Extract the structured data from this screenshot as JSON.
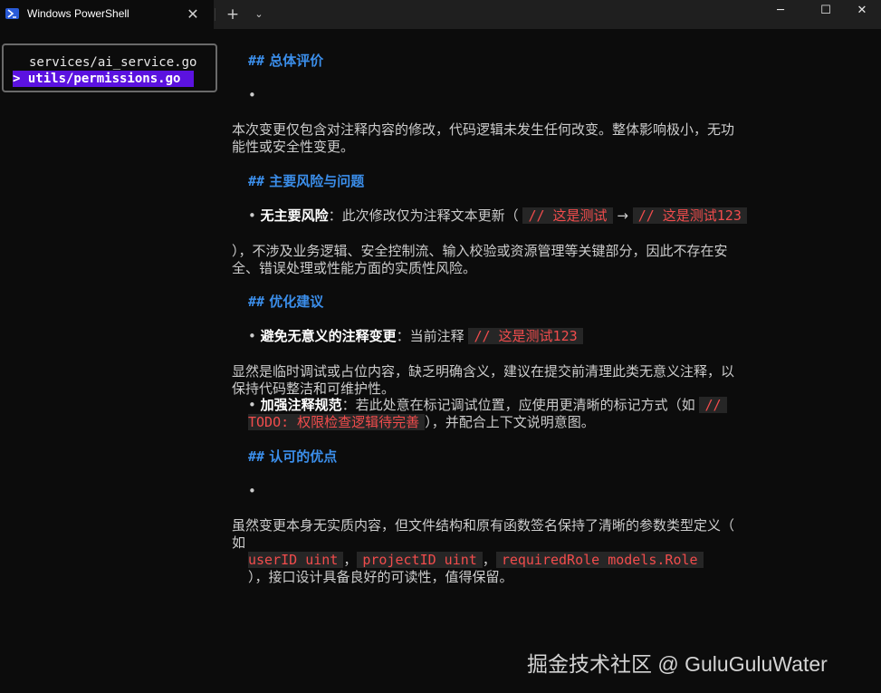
{
  "window": {
    "tab_title": "Windows PowerShell",
    "close_tab_glyph": "✕",
    "new_tab_glyph": "+",
    "dropdown_glyph": "⌄",
    "minimize_glyph": "─",
    "maximize_glyph": "☐",
    "close_glyph": "✕"
  },
  "picker": {
    "items": [
      {
        "label": "services/ai_service.go",
        "selected": false
      },
      {
        "label": "> utils/permissions.go",
        "selected": true
      }
    ]
  },
  "review": {
    "h1": {
      "hash": "##",
      "title": "总体评价"
    },
    "bullet": "•",
    "p1_line1": "本次变更仅包含对注释内容的修改，代码逻辑未发生任何改变。整体影响极小，无功",
    "p1_line2": "能性或安全性变更。",
    "h2": {
      "hash": "##",
      "title": "主要风险与问题"
    },
    "risk_label": "无主要风险",
    "risk_text": "：此次修改仅为注释文本更新（",
    "code_old": "// 这是测试",
    "arrow": "→",
    "code_new": "// 这是测试123",
    "p2_line1": "），不涉及业务逻辑、安全控制流、输入校验或资源管理等关键部分，因此不存在安",
    "p2_line2": "全、错误处理或性能方面的实质性风险。",
    "h3": {
      "hash": "##",
      "title": "优化建议"
    },
    "s1_label": "避免无意义的注释变更",
    "s1_text": "：当前注释",
    "s1_code": "// 这是测试123",
    "p3_line1": "显然是临时调试或占位内容，缺乏明确含义，建议在提交前清理此类无意义注释，以",
    "p3_line2": "保持代码整洁和可维护性。",
    "s2_label": "加强注释规范",
    "s2_text": "：若此处意在标记调试位置，应使用更清晰的标记方式（如",
    "s2_code_a": "//",
    "s2_code_b": "TODO: 权限检查逻辑待完善",
    "s2_tail": "），并配合上下文说明意图。",
    "h4": {
      "hash": "##",
      "title": "认可的优点"
    },
    "p4_line1": "虽然变更本身无实质内容，但文件结构和原有函数签名保持了清晰的参数类型定义（",
    "p4_line2": "如",
    "code_a": "userID uint",
    "code_b": "projectID uint",
    "code_c": "requiredRole models.Role",
    "comma": "，",
    "p4_tail": "），接口设计具备良好的可读性，值得保留。"
  },
  "watermark": "掘金技术社区 @ GuluGuluWater"
}
